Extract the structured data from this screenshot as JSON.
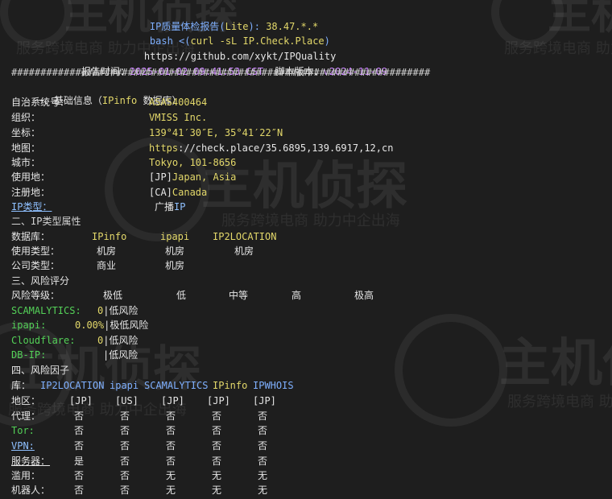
{
  "header": {
    "title_prefix": "IP质量体检报告(",
    "title_lite": "Lite",
    "title_suffix": "): ",
    "title_ip": "38.47.*.*",
    "cmd_bash": "bash <(",
    "cmd_curl": "curl -sL IP.Check.Place",
    "cmd_close": ")",
    "repo_url": "https://github.com/xykt/IPQuality",
    "report_time_label": "报告时间：",
    "report_time_value": "2025-01-02 09:41:53 CST",
    "script_version_label": "  脚本版本：",
    "script_version_value": "v2024-11-09",
    "separator": "########################################################################"
  },
  "basic": {
    "section_prefix": "一、基础信息（",
    "section_db": "IPinfo",
    "section_suffix": " 数据库）",
    "rows": [
      {
        "label": "自治系统号：",
        "value": "ASAS400464"
      },
      {
        "label": "组织：",
        "value": "VMISS Inc."
      },
      {
        "label": "坐标：",
        "value": "139°41′30″E, 35°41′22″N"
      },
      {
        "label": "地图：",
        "value_a": "https",
        "value_b": "://check.place/35.6895,139.6917,12,cn"
      },
      {
        "label": "城市：",
        "value": "Tokyo, 101-8656"
      },
      {
        "label": "使用地：",
        "code": "[JP]",
        "value": "Japan, Asia"
      },
      {
        "label": "注册地：",
        "code": "[CA]",
        "value": "Canada"
      },
      {
        "label": "IP类型：",
        "value_a": "广播",
        "value_b": "IP"
      }
    ]
  },
  "types": {
    "section": "二、IP类型属性",
    "db_label": "数据库：",
    "dbs": [
      "IPinfo",
      "ipapi",
      "IP2LOCATION"
    ],
    "use_label": "使用类型：",
    "use_values": [
      "机房",
      "机房",
      "机房"
    ],
    "company_label": "公司类型：",
    "company_values": [
      "商业",
      "机房"
    ]
  },
  "risk": {
    "section": "三、风险评分",
    "level_label": "风险等级：",
    "levels": [
      "极低",
      "低",
      "中等",
      "高",
      "极高"
    ],
    "rows": [
      {
        "name": "SCAMALYTICS:",
        "score": "0",
        "desc": "|低风险"
      },
      {
        "name": "ipapi:",
        "score": "0.00%",
        "desc": "|极低风险"
      },
      {
        "name": "Cloudflare:",
        "score": "0",
        "desc": "|低风险"
      },
      {
        "name": "DB-IP:",
        "score": "",
        "desc": "|低风险"
      }
    ]
  },
  "factors": {
    "section": "四、风险因子",
    "lib_label": "库：",
    "libs": [
      "IP2LOCATION",
      "ipapi",
      "SCAMALYTICS",
      "IPinfo",
      "IPWHOIS"
    ],
    "region_label": "地区：",
    "regions": [
      "[JP]",
      "[US]",
      "[JP]",
      "[JP]",
      "[JP]"
    ],
    "rows": [
      {
        "label": "代理：",
        "values": [
          "否",
          "否",
          "否",
          "否",
          "否"
        ]
      },
      {
        "label": "Tor:",
        "values": [
          "否",
          "否",
          "否",
          "否",
          "否"
        ]
      },
      {
        "label": "VPN:",
        "values": [
          "否",
          "否",
          "否",
          "否",
          "否"
        ]
      },
      {
        "label": "服务器：",
        "values": [
          "是",
          "否",
          "否",
          "否",
          "否"
        ]
      },
      {
        "label": "滥用：",
        "values": [
          "否",
          "否",
          "无",
          "无",
          "无"
        ]
      },
      {
        "label": "机器人：",
        "values": [
          "否",
          "否",
          "无",
          "无",
          "无"
        ]
      }
    ]
  },
  "watermark": {
    "brand": "主机侦探",
    "slogan": "服务跨境电商 助力中企出海"
  }
}
